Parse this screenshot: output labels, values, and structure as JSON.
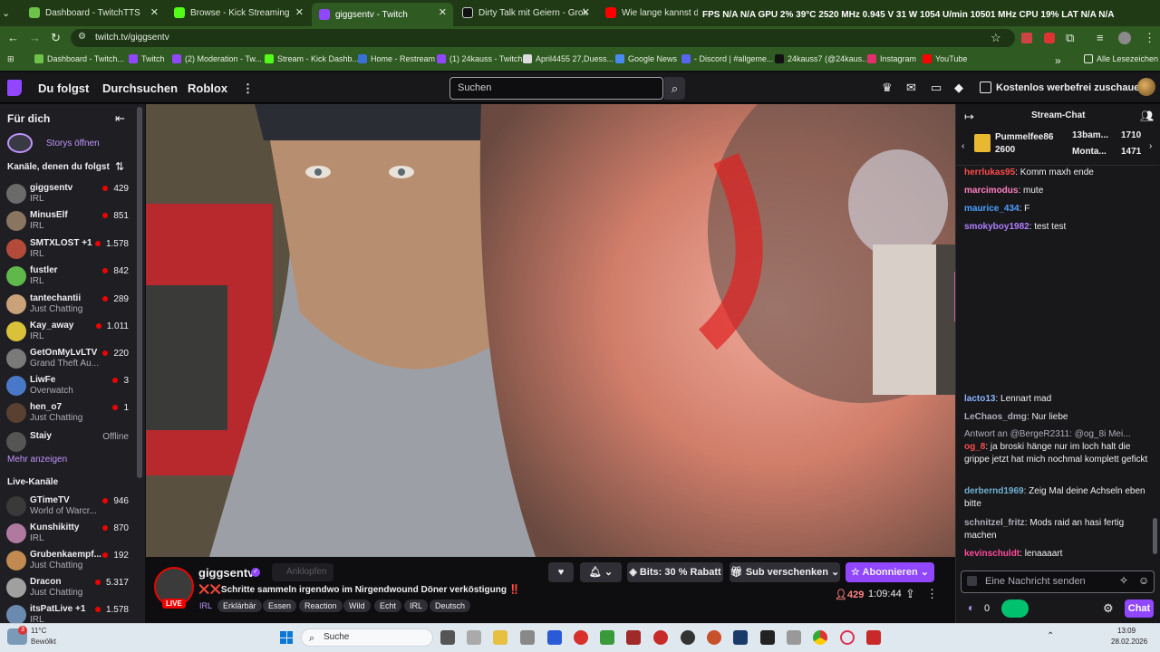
{
  "browser": {
    "tabs": [
      {
        "title": "Dashboard - TwitchTTS",
        "color": "#6cc24a"
      },
      {
        "title": "Browse - Kick Streaming",
        "color": "#53fc18"
      },
      {
        "title": "giggsentv - Twitch",
        "color": "#9147ff"
      },
      {
        "title": "Dirty Talk mit Geiern - Grok",
        "color": "#111111"
      },
      {
        "title": "Wie lange kannst du fasten b...",
        "color": "#ff0000"
      }
    ],
    "url": "twitch.tv/giggsentv",
    "bookmarks": [
      "Dashboard - Twitch...",
      "Twitch",
      "(2) Moderation - Tw...",
      "Stream - Kick Dashb...",
      "Home - Restream",
      "(1) 24kauss - Twitch",
      "April4455 27,Duess...",
      "Google News",
      "- Discord | #allgeme...",
      "24kauss7 (@24kaus...",
      "Instagram",
      "YouTube"
    ],
    "bookmarks_overflow": "»",
    "all_bookmarks": "Alle Lesezeichen"
  },
  "hud": "FPS N/A N/A  GPU 2% 39°C 2520 MHz 0.945 V 31 W 1054 U/min 10501 MHz  CPU 19% LAT N/A N/A",
  "twitch": {
    "nav": {
      "following": "Du folgst",
      "browse": "Durchsuchen",
      "roblox": "Roblox",
      "more": "⋮"
    },
    "search_placeholder": "Suchen",
    "promo": "Kostenlos werbefrei zuschauen"
  },
  "sidebar": {
    "for_you": "Für dich",
    "stories": "Storys öffnen",
    "followed_header": "Kanäle, denen du folgst",
    "followed": [
      {
        "name": "giggsentv",
        "game": "IRL",
        "viewers": "429",
        "color": "#6b6b6b"
      },
      {
        "name": "MinusElf",
        "game": "IRL",
        "viewers": "851",
        "color": "#8a7560"
      },
      {
        "name": "SMTXLOST +1",
        "game": "IRL",
        "viewers": "1.578",
        "color": "#b44a3a"
      },
      {
        "name": "fustler",
        "game": "IRL",
        "viewers": "842",
        "color": "#5fb84a"
      },
      {
        "name": "tantechantii",
        "game": "Just Chatting",
        "viewers": "289",
        "color": "#c9a27a"
      },
      {
        "name": "Kay_away",
        "game": "IRL",
        "viewers": "1.011",
        "color": "#d9c23a"
      },
      {
        "name": "GetOnMyLvLTV",
        "game": "Grand Theft Au...",
        "viewers": "220",
        "color": "#7a7a7a"
      },
      {
        "name": "LiwFe",
        "game": "Overwatch",
        "viewers": "3",
        "color": "#4a78c8"
      },
      {
        "name": "hen_o7",
        "game": "Just Chatting",
        "viewers": "1",
        "color": "#5a4030"
      }
    ],
    "offline": {
      "name": "Staiy",
      "status": "Offline"
    },
    "show_more": "Mehr anzeigen",
    "live_header": "Live-Kanäle",
    "live": [
      {
        "name": "GTimeTV",
        "game": "World of Warcr...",
        "viewers": "946",
        "color": "#3a3a3a"
      },
      {
        "name": "Kunshikitty",
        "game": "IRL",
        "viewers": "870",
        "color": "#b07aa0"
      },
      {
        "name": "Grubenkaempf...",
        "game": "Just Chatting",
        "viewers": "192",
        "color": "#c08a50"
      },
      {
        "name": "Dracon",
        "game": "Just Chatting",
        "viewers": "5.317",
        "color": "#a0a0a0"
      },
      {
        "name": "itsPatLive +1",
        "game": "IRL",
        "viewers": "1.578",
        "color": "#6a8ab0"
      }
    ]
  },
  "stream": {
    "channel": "giggsentv",
    "knock": "Anklopfen",
    "live_badge": "LIVE",
    "title": "❌❌Schritte sammeln irgendwo im Nirgendwound Döner verköstigung ‼️",
    "tags": [
      "IRL",
      "Erklärbär",
      "Essen",
      "Reaction",
      "Wild",
      "Echt",
      "IRL",
      "Deutsch"
    ],
    "bits_label": "Bits: 30 % Rabatt",
    "gift_label": "Sub verschenken",
    "subscribe_label": "Abonnieren",
    "viewers": "429",
    "uptime": "1:09:44"
  },
  "chat": {
    "title": "Stream-Chat",
    "hype": {
      "user": "Pummelfee86",
      "count": "2600",
      "top": [
        {
          "name": "13bam...",
          "value": "1710"
        },
        {
          "name": "Monta...",
          "value": "1471"
        }
      ]
    },
    "messages_top": [
      {
        "user": "herrlukas95",
        "text": ": Komm maxh ende",
        "color": "#ff4a4a"
      },
      {
        "user": "marcimodus",
        "text": ": mute",
        "color": "#ff7fbf"
      },
      {
        "user": "maurice_434",
        "text": ": F",
        "color": "#4aa0ff"
      },
      {
        "user": "smokyboy1982",
        "text": ": test test",
        "color": "#b07fff"
      }
    ],
    "messages_bottom": [
      {
        "user": "lacto13",
        "text": ": Lennart mad",
        "color": "#8ab4ff"
      },
      {
        "user": "LeChaos_dmg",
        "text": ": Nur liebe",
        "color": "#adadb8"
      },
      {
        "user": "og_8",
        "text": ": ja broski hänge nur im loch halt die grippe jetzt hat mich nochmal komplett gefickt",
        "color": "#ff4a4a",
        "reply": "Antwort an @BergeR2311: @og_8i Mei..."
      },
      {
        "user": "derbernd1969",
        "text": ": Zeig Mal deine Achseln eben bitte",
        "color": "#6fb0d0"
      },
      {
        "user": "schnitzel_fritz",
        "text": ": Mods raid an hasi fertig machen",
        "color": "#adadb8"
      },
      {
        "user": "kevinschuldt",
        "text": ": lenaaaart",
        "color": "#ff4a9a"
      }
    ],
    "input_placeholder": "Eine Nachricht senden",
    "points": "0",
    "chat_button": "Chat"
  },
  "taskbar": {
    "weather_temp": "11°C",
    "weather_desc": "Bewölkt",
    "search": "Suche",
    "time": "13:09",
    "date": "28.02.2026"
  }
}
